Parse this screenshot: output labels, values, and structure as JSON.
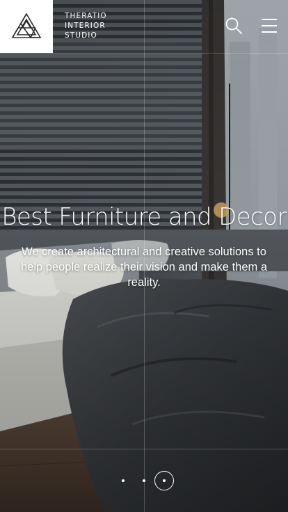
{
  "header": {
    "brand_lines": [
      "THERATIO",
      "INTERIOR",
      "STUDIO"
    ],
    "logo_icon": "impossible-triangle-icon",
    "search_icon": "search-icon",
    "menu_icon": "hamburger-menu-icon"
  },
  "hero": {
    "title": "Best Furniture and Decor",
    "subtitle": "We create architectural and creative solutions to help people realize their vision and make them a reality."
  },
  "slider": {
    "slide_count": 3,
    "active_index": 2
  },
  "colors": {
    "text": "#ffffff",
    "logo_background": "#ffffff",
    "logo_stroke": "#2a2a2a"
  }
}
